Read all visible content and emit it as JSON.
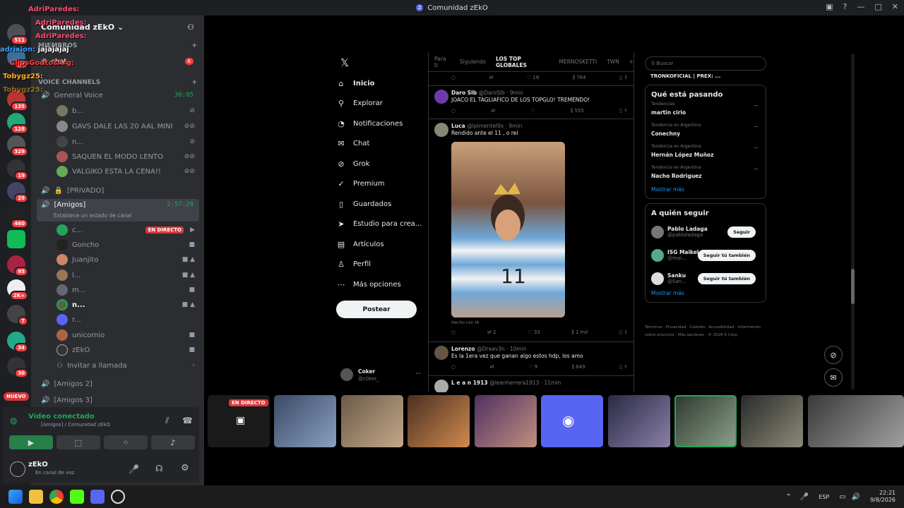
{
  "window": {
    "title": "Comunidad zEkO"
  },
  "guild": {
    "name": "Comunidad zEkO"
  },
  "categories": {
    "members": "MIEMBROS",
    "voice": "VOICE CHANNELS"
  },
  "chat_channel": "chat",
  "chat_badge": "6",
  "general_voice": {
    "name": "General Voice",
    "time": "30:05"
  },
  "general_users": [
    "b...",
    "GAVS DALE LAS 20 AAL MINI",
    "n...",
    "SAQUEN EL MODO LENTO",
    "VALGIKO ESTA LA CENA!!"
  ],
  "privado": "[PRIVADO]",
  "amigos": {
    "name": "[Amigos]",
    "time": "2:57:20",
    "status": "Establece un estado de canal"
  },
  "amigos_users": [
    "c...",
    "Goncho",
    "Juanjito",
    "l...",
    "m...",
    "n...",
    "r...",
    "unicornio",
    "zEkO"
  ],
  "live_label": "EN DIRECTO",
  "invite": "Invitar a llamada",
  "amigos2": "[Amigos 2]",
  "amigos3": "[Amigos 3]",
  "nuevo": "NUEVO",
  "voice_panel": {
    "title": "Vídeo conectado",
    "sub": "[Amigos] / Comunidad zEkO"
  },
  "user": {
    "name": "zEkO",
    "status": "En canal de voz"
  },
  "server_badges": [
    "511",
    "11",
    "135",
    "128",
    "329",
    "19",
    "29",
    "460",
    "95",
    "2K+",
    "7",
    "34",
    "30"
  ],
  "overlay_chat": [
    {
      "user": "AdriParedes:",
      "msg": "",
      "color": "#ff4d6d"
    },
    {
      "user": "AdriParedes:",
      "msg": "",
      "color": "#ff4d6d"
    },
    {
      "user": "AdriParedes:",
      "msg": "",
      "color": "#ff4d6d"
    },
    {
      "user": "adrixion:",
      "msg": "jajajajaj",
      "color": "#3aa0ff"
    },
    {
      "user": "ClipsGodtosArg:",
      "msg": "",
      "color": "#ff3b3b"
    },
    {
      "user": "Tobygz25:",
      "msg": "",
      "color": "#ffb020"
    },
    {
      "user": "Tobygz25:",
      "msg": "",
      "color": "#ffb020"
    }
  ],
  "x_nav": [
    {
      "icon": "home-icon",
      "glyph": "⌂",
      "label": "Inicio"
    },
    {
      "icon": "search-icon",
      "glyph": "⚲",
      "label": "Explorar"
    },
    {
      "icon": "bell-icon",
      "glyph": "◔",
      "label": "Notificaciones"
    },
    {
      "icon": "chat-icon",
      "glyph": "✉",
      "label": "Chat"
    },
    {
      "icon": "grok-icon",
      "glyph": "⊘",
      "label": "Grok"
    },
    {
      "icon": "premium-icon",
      "glyph": "✓",
      "label": "Premium"
    },
    {
      "icon": "bookmark-icon",
      "glyph": "▯",
      "label": "Guardados"
    },
    {
      "icon": "studio-icon",
      "glyph": "➤",
      "label": "Estudio para crea..."
    },
    {
      "icon": "article-icon",
      "glyph": "▤",
      "label": "Artículos"
    },
    {
      "icon": "profile-icon",
      "glyph": "♙",
      "label": "Perfil"
    },
    {
      "icon": "more-icon",
      "glyph": "⋯",
      "label": "Más opciones"
    }
  ],
  "x_post": "Postear",
  "x_account": {
    "name": "Coker",
    "handle": "@c0ker_"
  },
  "x_tabs": [
    "Para ti",
    "Siguiendo",
    "LOS TOP GLOBALES",
    "MERNOSKETTI",
    "TWN"
  ],
  "tweets": [
    {
      "name": "Daro Slb",
      "handle": "@DaroSlb · 9min",
      "text": "JOACO EL TAGLIAFICO DE LOS TOPGLO! TREMENDO!",
      "stats": [
        "",
        "",
        "",
        "555"
      ]
    },
    {
      "name": "Luca",
      "handle": "@lpimentel9x · 9min",
      "text": "Rendido ante el 11 , o rei",
      "stats": [
        "",
        "2",
        "33",
        "1 mil"
      ],
      "label": "Hecho con IA"
    },
    {
      "name": "Lorenzo",
      "handle": "@Draav3n · 10min",
      "text": "Es la 1era vez que ganan algo estos hdp, los amo",
      "stats": [
        "",
        "",
        "9",
        "649"
      ]
    },
    {
      "name": "L e a n 1913",
      "handle": "@leanherrera1913 · 11min",
      "text": "",
      "stats": []
    }
  ],
  "top_stats": [
    "",
    "",
    "18",
    "764"
  ],
  "search_placeholder": "Buscar",
  "top_user": "TRONKOFICIAL | PREX: ...",
  "trends_title": "Qué está pasando",
  "trends": [
    {
      "ctx": "Tendencias",
      "name": "martin cirio"
    },
    {
      "ctx": "Tendencia en Argentina",
      "name": "Conechny"
    },
    {
      "ctx": "Tendencia en Argentina",
      "name": "Hernán López Muñoz"
    },
    {
      "ctx": "Tendencia en Argentina",
      "name": "Nacho Rodriguez"
    }
  ],
  "show_more": "Mostrar más",
  "follow_title": "A quién seguir",
  "follow": [
    {
      "name": "Pablo Ladaga",
      "handle": "@pabloladaga",
      "btn": "Seguir"
    },
    {
      "name": "ISG Maikel",
      "handle": "@mai...",
      "btn": "Seguir tú también"
    },
    {
      "name": "Sanku",
      "handle": "@San...",
      "btn": "Seguir tú también"
    }
  ],
  "x_footer": "Términos · Privacidad · Cookies · Accesibilidad · Información sobre anuncios · Más opciones · © 2026 X Corp.",
  "taskbar": {
    "lang": "ESP",
    "time": "22:21",
    "date": "9/8/2026"
  }
}
